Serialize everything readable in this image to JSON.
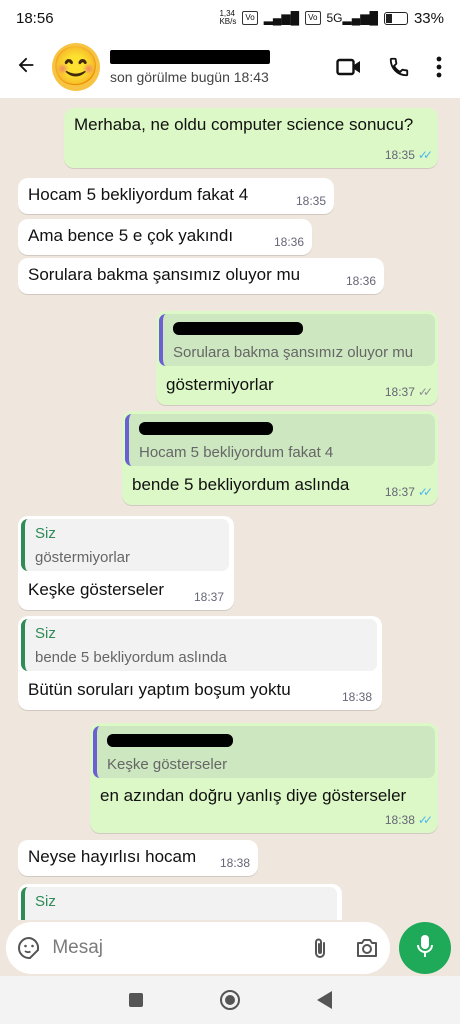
{
  "status_bar": {
    "time": "18:56",
    "net_speed": "1,34\nKB/s",
    "battery": "33%"
  },
  "header": {
    "status": "son görülme bugün 18:43"
  },
  "messages": [
    {
      "text": "Merhaba, ne oldu computer science sonucu?",
      "time": "18:35"
    },
    {
      "text": "Hocam 5 bekliyordum fakat 4",
      "time": "18:35"
    },
    {
      "text": "Ama bence 5 e çok yakındı",
      "time": "18:36"
    },
    {
      "text": "Sorulara bakma şansımız oluyor mu",
      "time": "18:36"
    },
    {
      "quote": "Sorulara bakma şansımız oluyor mu",
      "text": "göstermiyorlar",
      "time": "18:37"
    },
    {
      "quote": "Hocam 5 bekliyordum fakat 4",
      "text": "bende 5 bekliyordum aslında",
      "time": "18:37"
    },
    {
      "quote_author": "Siz",
      "quote": "göstermiyorlar",
      "text": "Keşke gösterseler",
      "time": "18:37"
    },
    {
      "quote_author": "Siz",
      "quote": "bende 5 bekliyordum aslında",
      "text": "Bütün soruları yaptım boşum yoktu",
      "time": "18:38"
    },
    {
      "quote": "Keşke gösterseler",
      "text": "en azından doğru yanlış diye gösterseler",
      "time": "18:38"
    },
    {
      "text": "Neyse hayırlısı hocam",
      "time": "18:38"
    },
    {
      "quote_author": "Siz"
    }
  ],
  "composer": {
    "placeholder": "Mesaj"
  },
  "colors": {
    "accent": "#1faa59",
    "outgoing": "#dcf8c6",
    "read_ticks": "#4fb6ec"
  }
}
